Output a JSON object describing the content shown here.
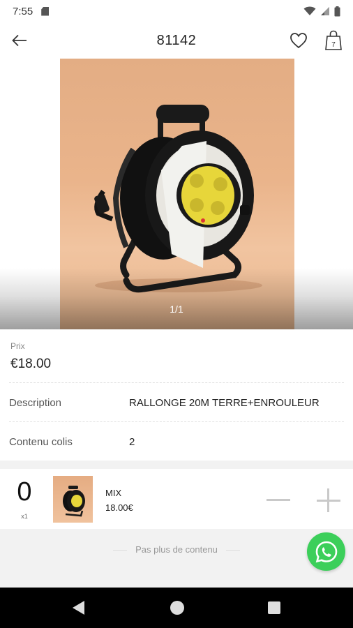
{
  "status_bar": {
    "time": "7:55",
    "icons": [
      "sd-card-icon",
      "wifi-icon",
      "signal-icon",
      "battery-icon"
    ]
  },
  "app_bar": {
    "title": "81142",
    "cart_count": "7",
    "icons": [
      "back-arrow-icon",
      "heart-icon",
      "shopping-bag-icon"
    ]
  },
  "gallery": {
    "counter": "1/1",
    "image": "cable-reel-extension-photo"
  },
  "product": {
    "price_label": "Prix",
    "price": "€18.00",
    "rows": [
      {
        "label": "Description",
        "value": "RALLONGE 20M TERRE+ENROULEUR"
      },
      {
        "label": "Contenu colis",
        "value": "2"
      }
    ]
  },
  "cart": {
    "quantity": "0",
    "multiplier": "x1",
    "variant_name": "MIX",
    "variant_price": "18.00€"
  },
  "footer": {
    "end_text": "Pas plus de contenu"
  },
  "colors": {
    "accent_whatsapp": "#3ccf5a",
    "background": "#f2f2f2"
  }
}
